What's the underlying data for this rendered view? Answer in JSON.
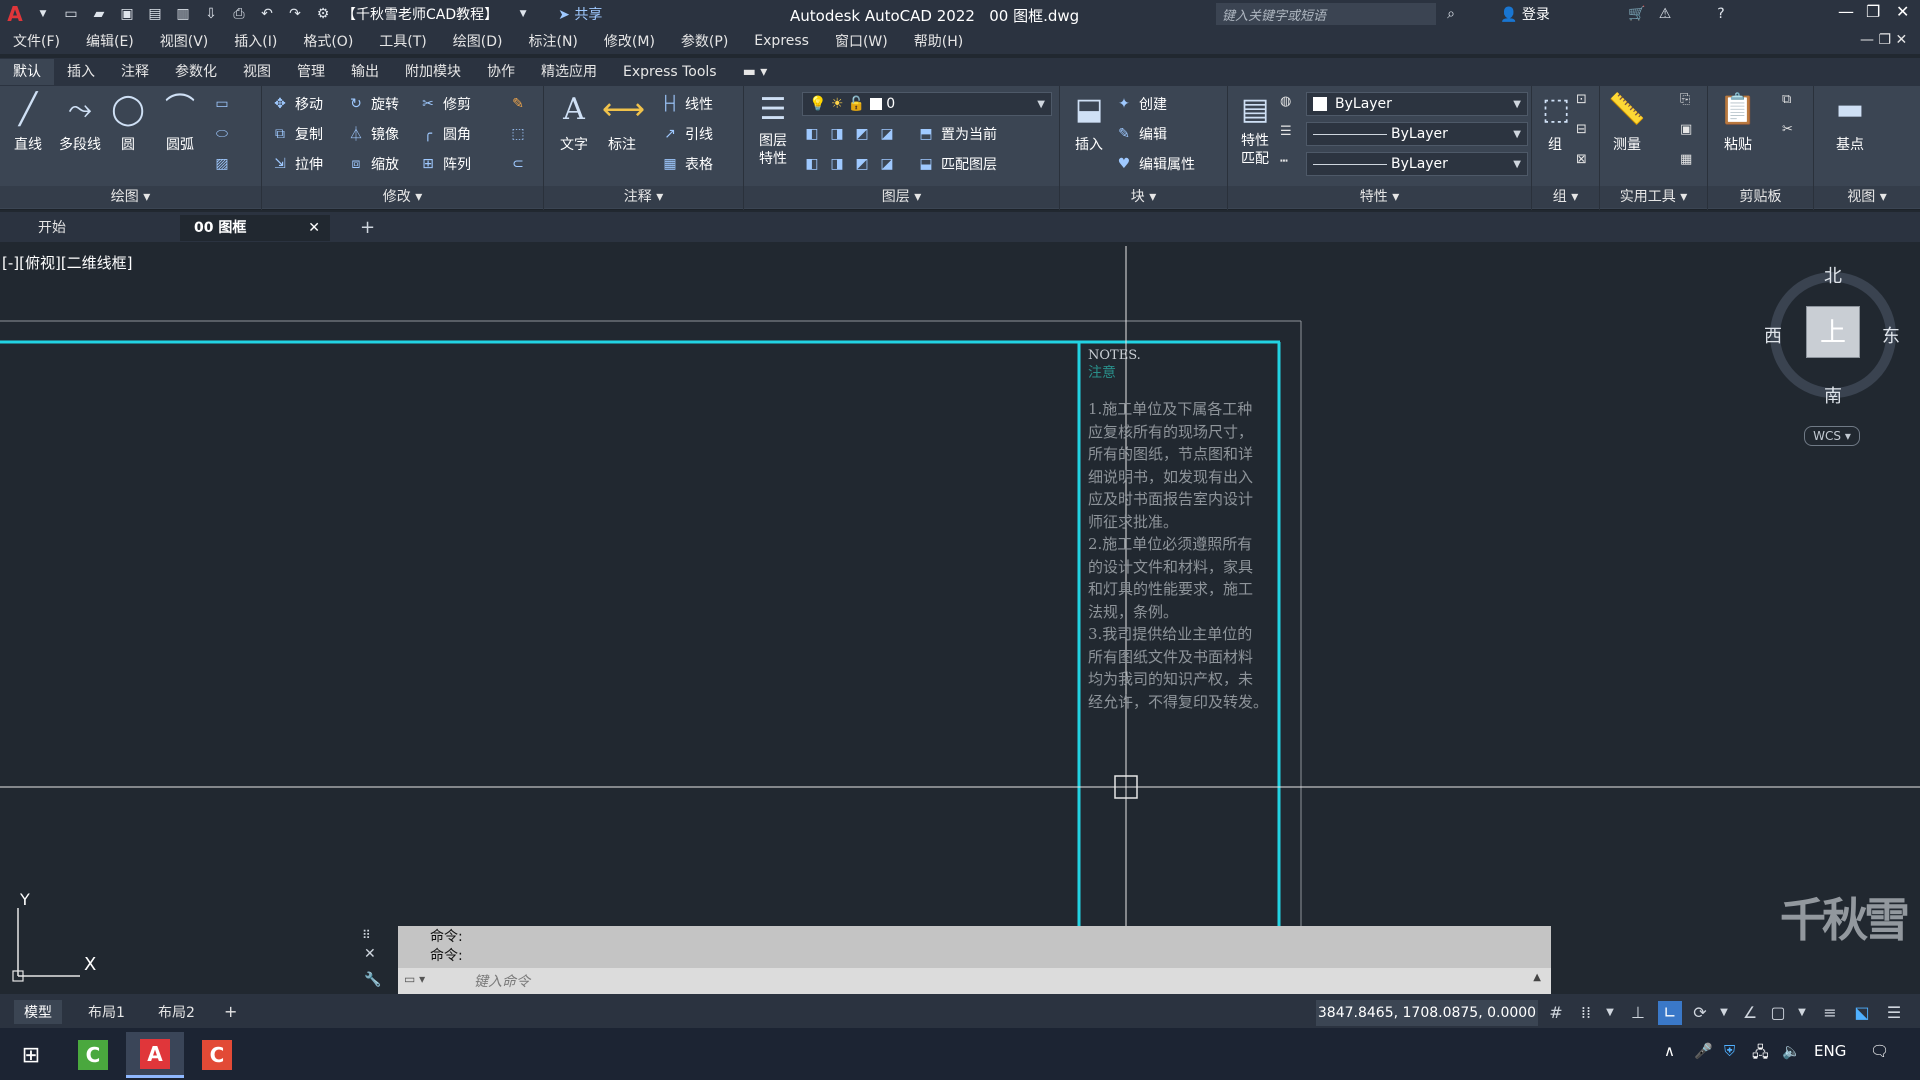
{
  "titlebar": {
    "app_logo": "A",
    "workspace": "【千秋雪老师CAD教程】",
    "share_label": "共享",
    "app_title": "Autodesk AutoCAD 2022",
    "file_name": "00 图框.dwg",
    "search_placeholder": "键入关键字或短语",
    "login_label": "登录"
  },
  "menu": [
    "文件(F)",
    "编辑(E)",
    "视图(V)",
    "插入(I)",
    "格式(O)",
    "工具(T)",
    "绘图(D)",
    "标注(N)",
    "修改(M)",
    "参数(P)",
    "Express",
    "窗口(W)",
    "帮助(H)"
  ],
  "ribbon_tabs": [
    "默认",
    "插入",
    "注释",
    "参数化",
    "视图",
    "管理",
    "输出",
    "附加模块",
    "协作",
    "精选应用",
    "Express Tools"
  ],
  "ribbon": {
    "draw": {
      "title": "绘图",
      "line": "直线",
      "polyline": "多段线",
      "circle": "圆",
      "arc": "圆弧"
    },
    "modify": {
      "title": "修改",
      "move": "移动",
      "rotate": "旋转",
      "trim": "修剪",
      "copy": "复制",
      "mirror": "镜像",
      "fillet": "圆角",
      "stretch": "拉伸",
      "scale": "缩放",
      "array": "阵列"
    },
    "annotation": {
      "title": "注释",
      "text": "文字",
      "dimension": "标注",
      "linear": "线性",
      "leader": "引线",
      "table": "表格"
    },
    "layers": {
      "title": "图层",
      "layer_props_1": "图层",
      "layer_props_2": "特性",
      "current_layer": "0",
      "set_current": "置为当前",
      "match_layer": "匹配图层"
    },
    "block": {
      "title": "块",
      "insert": "插入",
      "create": "创建",
      "edit": "编辑",
      "edit_attr": "编辑属性"
    },
    "properties": {
      "title": "特性",
      "match_1": "特性",
      "match_2": "匹配",
      "color": "ByLayer",
      "linetype": "ByLayer",
      "lineweight": "ByLayer"
    },
    "groups": {
      "title": "组",
      "group": "组"
    },
    "utilities": {
      "title": "实用工具",
      "measure": "测量"
    },
    "clipboard": {
      "title": "剪贴板",
      "paste": "粘贴"
    },
    "view": {
      "title": "视图",
      "base": "基点"
    }
  },
  "doc_tabs": {
    "start": "开始",
    "current": "00 图框"
  },
  "viewport": {
    "label": "[-][俯视][二维线框]",
    "compass": {
      "north": "北",
      "south": "南",
      "east": "东",
      "west": "西",
      "top": "上"
    },
    "wcs": "WCS"
  },
  "notes": {
    "title_en": "NOTES.",
    "title_cn": "注意",
    "lines": [
      "1.施工单位及下属各工种",
      "应复核所有的现场尺寸，",
      "所有的图纸，节点图和详",
      "细说明书，如发现有出入",
      "应及时书面报告室内设计",
      "师征求批准。",
      "2.施工单位必须遵照所有",
      "的设计文件和材料，家具",
      "和灯具的性能要求，施工",
      "法规，条例。",
      "3.我司提供给业主单位的",
      "所有图纸文件及书面材料",
      "均为我司的知识产权，未",
      "经允许，不得复印及转发。"
    ]
  },
  "command": {
    "history_1": "命令:",
    "history_2": "命令:",
    "placeholder": "键入命令"
  },
  "layout_tabs": [
    "模型",
    "布局1",
    "布局2"
  ],
  "status": {
    "coordinates": "3847.8465, 1708.0875, 0.0000"
  },
  "taskbar": {
    "language": "ENG"
  },
  "watermark": "千秋雪"
}
